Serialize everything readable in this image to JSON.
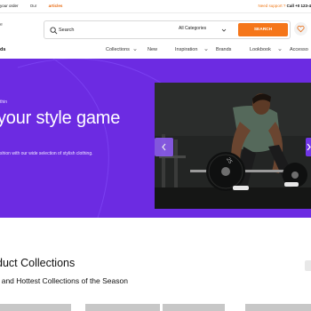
{
  "topbar": {
    "track_order": "your order",
    "our_articles_prefix": "Our",
    "our_articles_highlight": "articles",
    "need_support": "Need support ?",
    "call": "Call +0 123-4"
  },
  "header": {
    "brand_fragment_top": "e",
    "brand_fragment_nav": "ds",
    "search": {
      "placeholder": "Search",
      "category_selected": "All Categories",
      "button_label": "SEARCH"
    },
    "wishlist_icon": "heart-icon"
  },
  "nav": {
    "items": [
      "Collections",
      "New",
      "Inspiration",
      "Brands",
      "Lookbook",
      "Accesso"
    ]
  },
  "hero": {
    "eyebrow": "thin",
    "title": "your style game",
    "subtitle": "shion with our wide selection of stylish clothing.",
    "background_color": "#6c2be2",
    "image_alt": "man-lifting-barbell"
  },
  "collections": {
    "title": "duct Collections",
    "subtitle": "t and Hottest Collections of the Season"
  },
  "colors": {
    "accent": "#f5761a",
    "hero": "#6c2be2"
  }
}
